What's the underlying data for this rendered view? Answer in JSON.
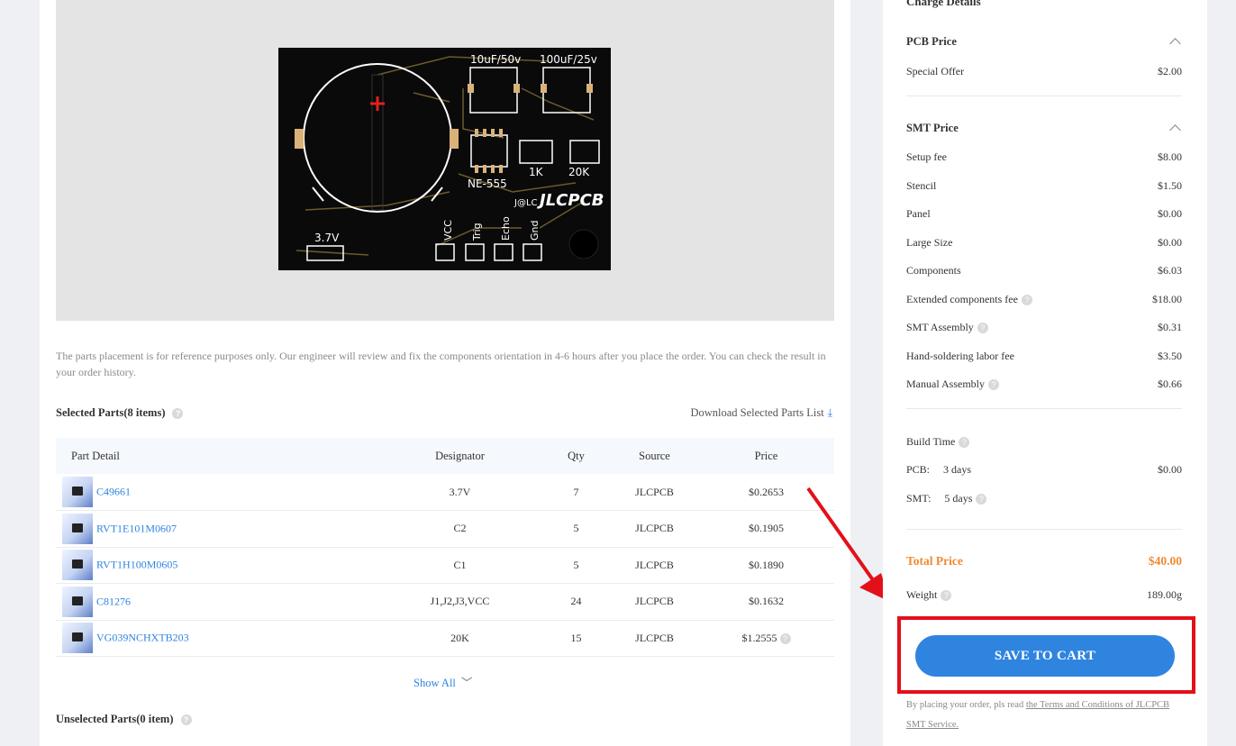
{
  "preview": {
    "pcb_labels": {
      "cap1": "10uF/50v",
      "cap2": "100uF/25v",
      "r1": "1K",
      "r2": "20K",
      "ic": "NE-555",
      "brand": "JLCPCB",
      "logo_mark": "J@LC",
      "battery": "3.7V",
      "pin1": "VCC",
      "pin2": "Trig",
      "pin3": "Echo",
      "pin4": "Gnd"
    }
  },
  "note": "The parts placement is for reference purposes only. Our engineer will review and fix the components orientation in 4-6 hours after you place the order. You can check the result in your order history.",
  "selected_parts": {
    "title": "Selected Parts(8 items)",
    "download_label": "Download Selected Parts List",
    "columns": [
      "Part Detail",
      "Designator",
      "Qty",
      "Source",
      "Price"
    ],
    "rows": [
      {
        "part": "C49661",
        "designator": "3.7V",
        "qty": "7",
        "source": "JLCPCB",
        "price": "$0.2653"
      },
      {
        "part": "RVT1E101M0607",
        "designator": "C2",
        "qty": "5",
        "source": "JLCPCB",
        "price": "$0.1905"
      },
      {
        "part": "RVT1H100M0605",
        "designator": "C1",
        "qty": "5",
        "source": "JLCPCB",
        "price": "$0.1890"
      },
      {
        "part": "C81276",
        "designator": "J1,J2,J3,VCC",
        "qty": "24",
        "source": "JLCPCB",
        "price": "$0.1632"
      },
      {
        "part": "VG039NCHXTB203",
        "designator": "20K",
        "qty": "15",
        "source": "JLCPCB",
        "price": "$1.2555"
      }
    ],
    "show_all": "Show All"
  },
  "unselected_parts": {
    "title": "Unselected Parts(0 item)"
  },
  "charge": {
    "heading": "Charge Details",
    "pcb_section": {
      "title": "PCB Price",
      "items": [
        {
          "label": "Special Offer",
          "value": "$2.00"
        }
      ]
    },
    "smt_section": {
      "title": "SMT Price",
      "items": [
        {
          "label": "Setup fee",
          "value": "$8.00"
        },
        {
          "label": "Stencil",
          "value": "$1.50"
        },
        {
          "label": "Panel",
          "value": "$0.00"
        },
        {
          "label": "Large Size",
          "value": "$0.00"
        },
        {
          "label": "Components",
          "value": "$6.03"
        },
        {
          "label": "Extended components fee",
          "value": "$18.00"
        },
        {
          "label": "SMT Assembly",
          "value": "$0.31"
        },
        {
          "label": "Hand-soldering labor fee",
          "value": "$3.50"
        },
        {
          "label": "Manual Assembly",
          "value": "$0.66"
        }
      ]
    },
    "build_time": {
      "title": "Build Time",
      "pcb_label": "PCB:",
      "pcb_days": "3 days",
      "pcb_value": "$0.00",
      "smt_label": "SMT:",
      "smt_days": "5 days"
    },
    "total_label": "Total Price",
    "total_value": "$40.00",
    "weight_label": "Weight",
    "weight_value": "189.00g",
    "save_button": "SAVE TO CART",
    "terms_prefix": "By placing your order, pls read ",
    "terms_link": "the Terms and Conditions of JLCPCB SMT Service."
  },
  "colors": {
    "accent": "#2f84e0",
    "total": "#f08a32",
    "highlight": "#e3101a"
  }
}
